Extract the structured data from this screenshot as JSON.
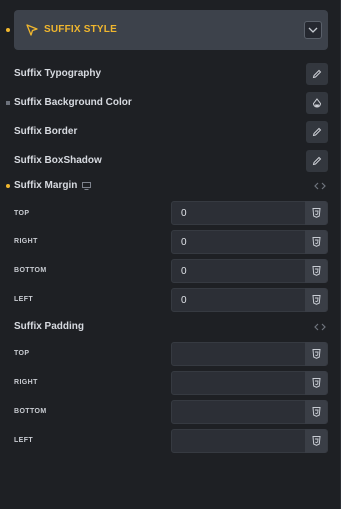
{
  "section": {
    "title": "SUFFIX STYLE",
    "header_icon": "cursor-icon",
    "toggle_icon": "chevron-down-icon"
  },
  "controls": {
    "typography": {
      "label": "Suffix Typography",
      "icon": "pencil-icon"
    },
    "background_color": {
      "label": "Suffix Background Color",
      "icon": "color-drop-icon"
    },
    "border": {
      "label": "Suffix Border",
      "icon": "pencil-icon"
    },
    "box_shadow": {
      "label": "Suffix BoxShadow",
      "icon": "pencil-icon"
    }
  },
  "margin": {
    "label": "Suffix Margin",
    "device_icon": "desktop-icon",
    "link_icon": "link-icon",
    "fields": [
      {
        "label": "TOP",
        "value": "0",
        "unit_icon": "css-unit-icon"
      },
      {
        "label": "RIGHT",
        "value": "0",
        "unit_icon": "css-unit-icon"
      },
      {
        "label": "BOTTOM",
        "value": "0",
        "unit_icon": "css-unit-icon"
      },
      {
        "label": "LEFT",
        "value": "0",
        "unit_icon": "css-unit-icon"
      }
    ]
  },
  "padding": {
    "label": "Suffix Padding",
    "link_icon": "link-icon",
    "fields": [
      {
        "label": "TOP",
        "value": "",
        "unit_icon": "css-unit-icon"
      },
      {
        "label": "RIGHT",
        "value": "",
        "unit_icon": "css-unit-icon"
      },
      {
        "label": "BOTTOM",
        "value": "",
        "unit_icon": "css-unit-icon"
      },
      {
        "label": "LEFT",
        "value": "",
        "unit_icon": "css-unit-icon"
      }
    ]
  },
  "colors": {
    "accent": "#f0b62e",
    "background": "#1e2024",
    "header_bg": "#3d424b",
    "field_bg": "#2c2f36"
  }
}
